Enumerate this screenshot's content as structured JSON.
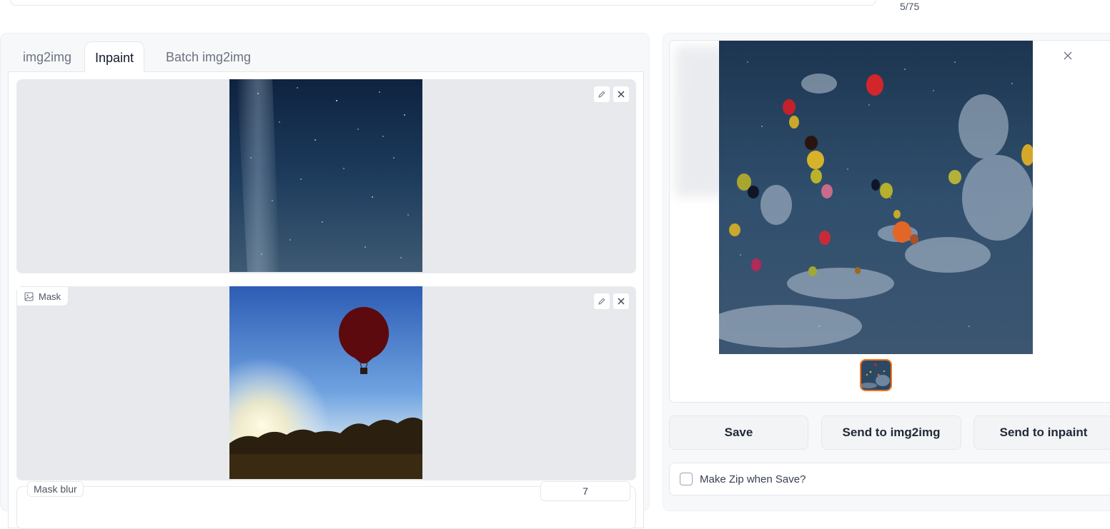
{
  "prompt": {
    "token_count": "5/75"
  },
  "tabs": [
    {
      "label": "img2img"
    },
    {
      "label": "Inpaint"
    },
    {
      "label": "Batch img2img"
    }
  ],
  "active_tab": "Inpaint",
  "inpaint": {
    "mask_label": "Mask",
    "mask_blur": {
      "label": "Mask blur",
      "value": "7"
    }
  },
  "actions": {
    "save": "Save",
    "send_img2img": "Send to img2img",
    "send_inpaint": "Send to inpaint"
  },
  "options": {
    "make_zip": "Make Zip when Save?"
  },
  "colors": {
    "accent": "#f97316",
    "panel": "#f7f8fa",
    "border": "#e5e7eb"
  }
}
